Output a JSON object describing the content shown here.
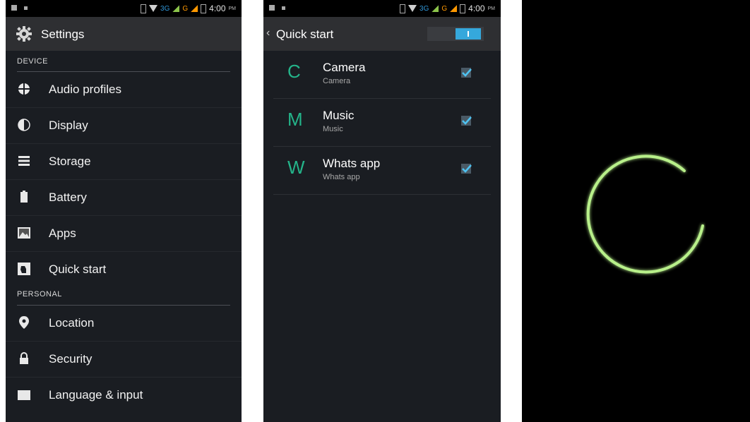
{
  "status_bar": {
    "network": "3G",
    "signal2": "G",
    "time": "4:00",
    "ampm": "PM"
  },
  "settings": {
    "title": "Settings",
    "device_header": "DEVICE",
    "device_items": [
      {
        "label": "Audio profiles"
      },
      {
        "label": "Display"
      },
      {
        "label": "Storage"
      },
      {
        "label": "Battery"
      },
      {
        "label": "Apps"
      },
      {
        "label": "Quick start"
      }
    ],
    "personal_header": "PERSONAL",
    "personal_items": [
      {
        "label": "Location"
      },
      {
        "label": "Security"
      },
      {
        "label": "Language & input"
      }
    ]
  },
  "quick_start": {
    "title": "Quick start",
    "toggle_on": true,
    "items": [
      {
        "letter": "C",
        "title": "Camera",
        "subtitle": "Camera",
        "checked": true
      },
      {
        "letter": "M",
        "title": "Music",
        "subtitle": "Music",
        "checked": true
      },
      {
        "letter": "W",
        "title": "Whats app",
        "subtitle": "Whats app",
        "checked": true
      }
    ]
  },
  "colors": {
    "accent": "#24b48a",
    "toggle": "#35a8dc",
    "spinner": "#b8f08a"
  }
}
